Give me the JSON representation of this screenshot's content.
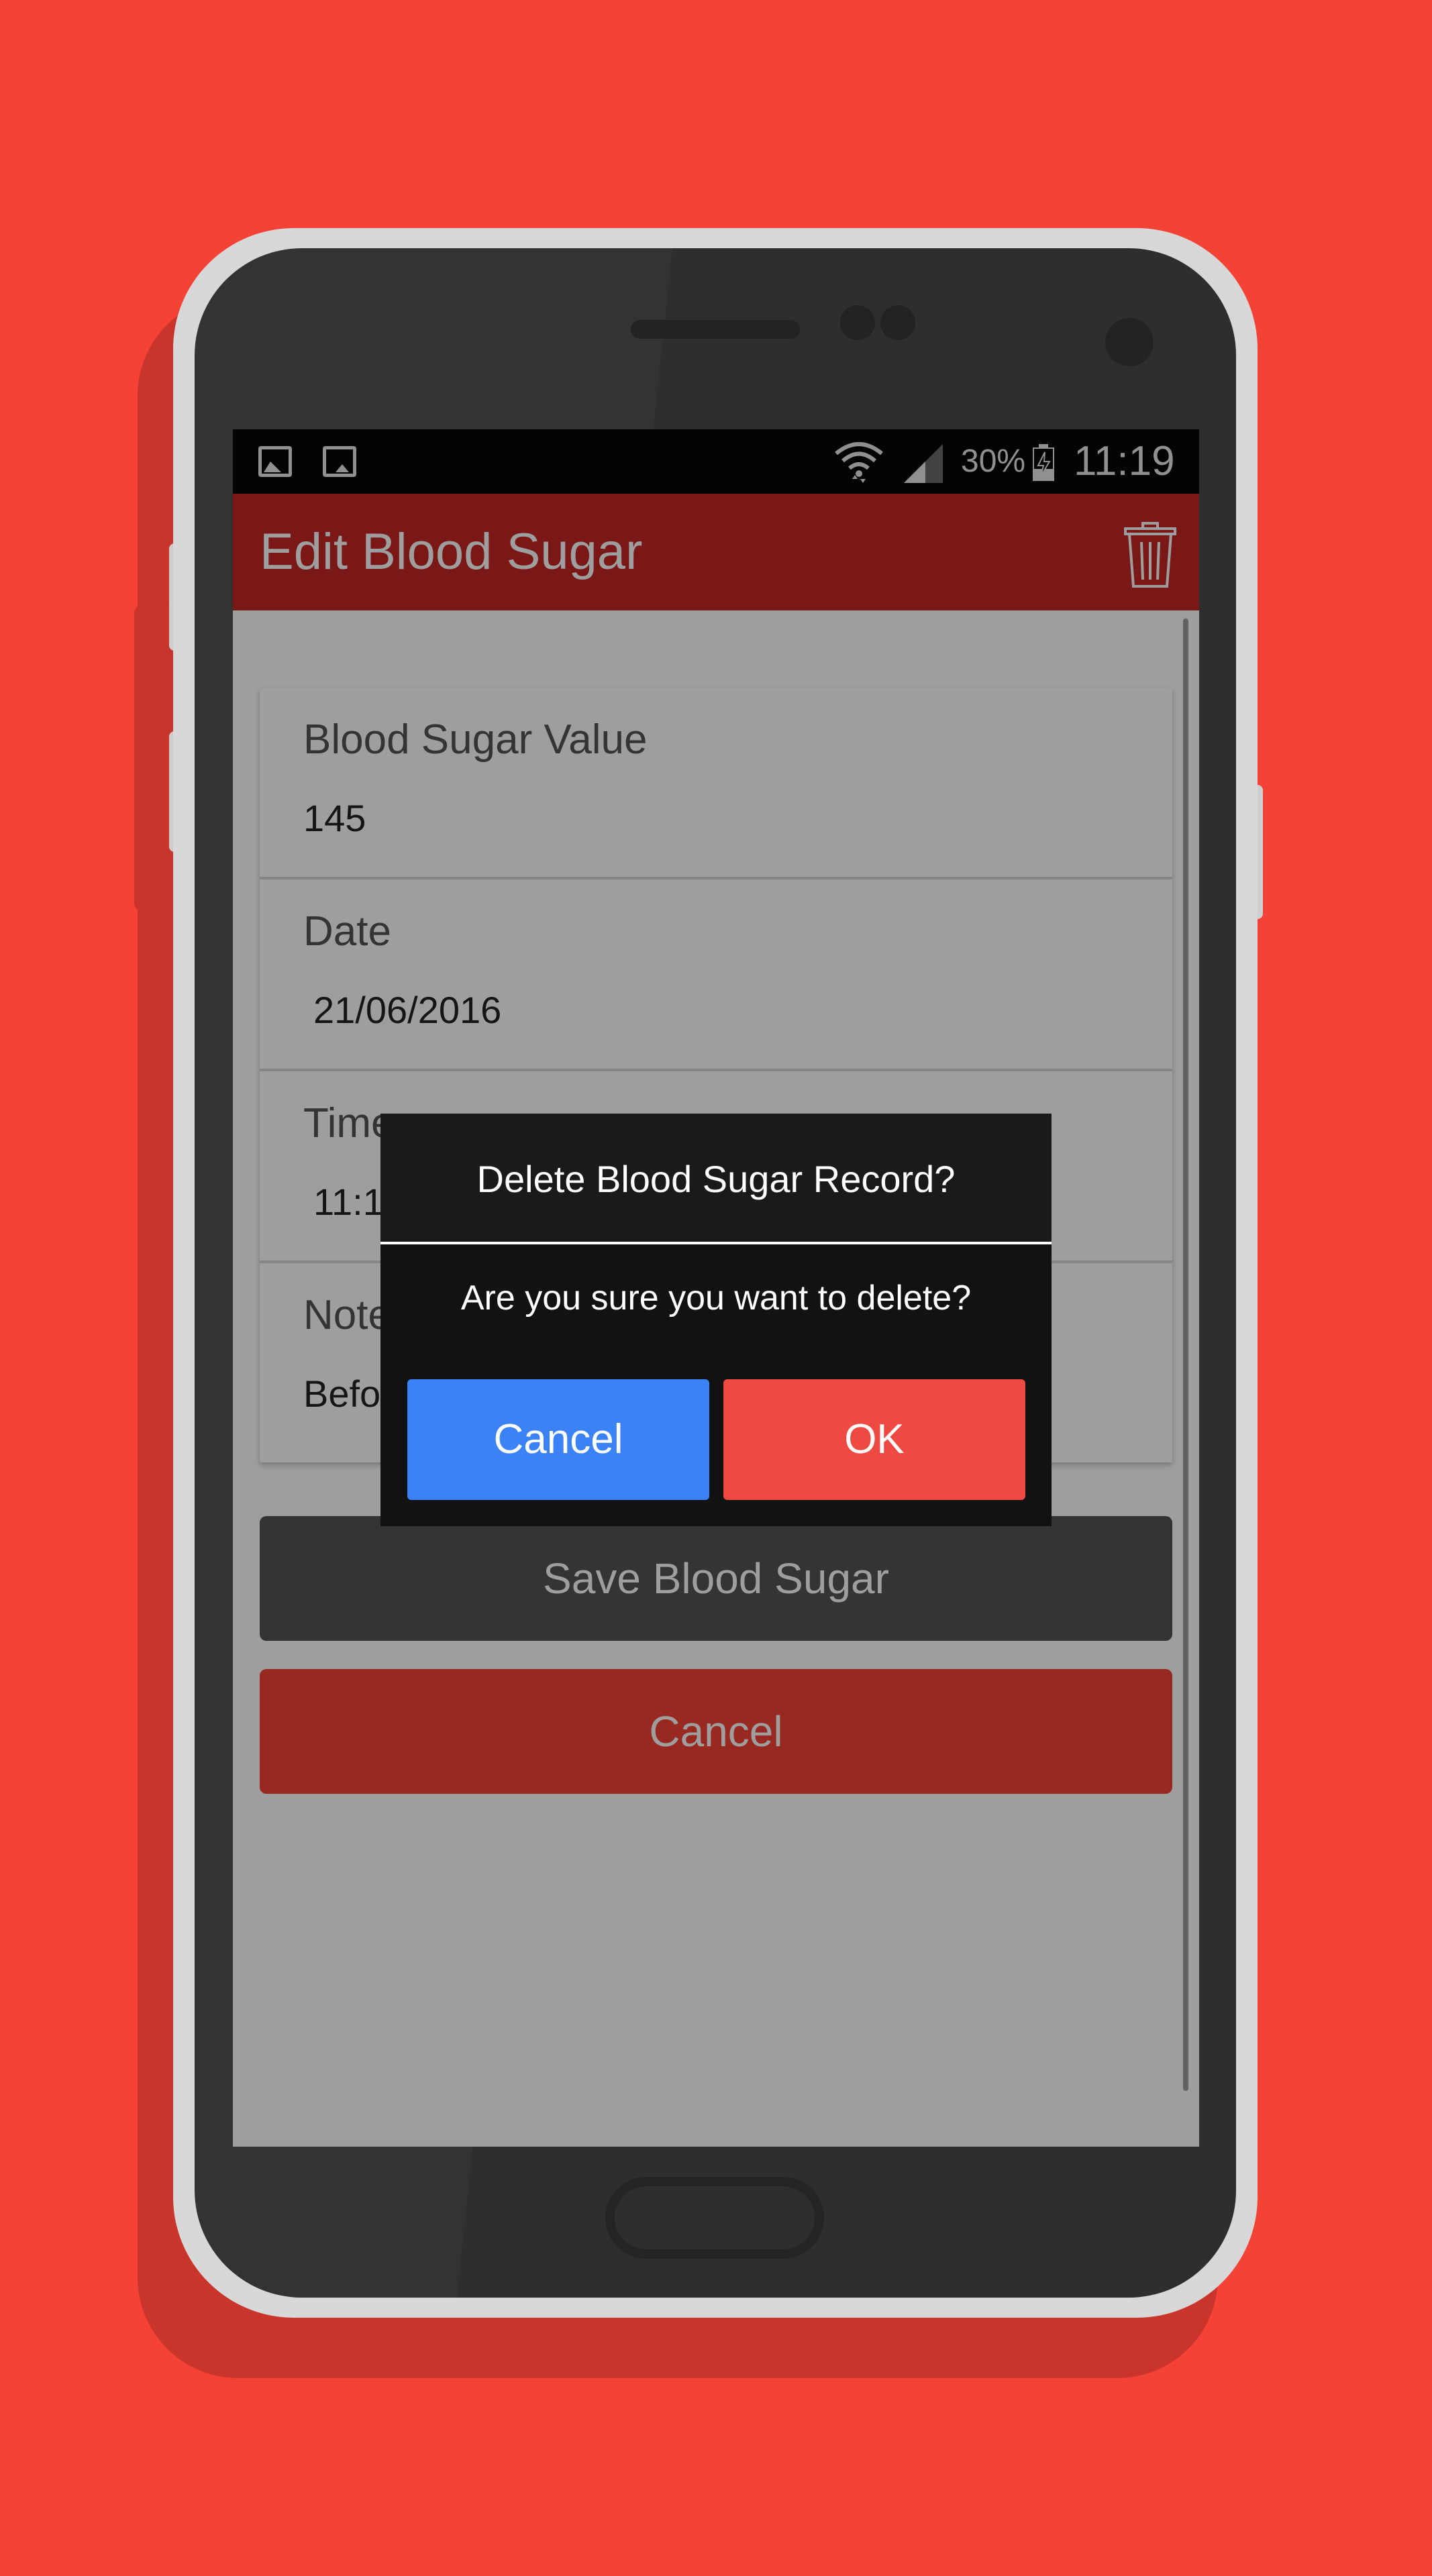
{
  "status_bar": {
    "battery_percent": "30%",
    "clock": "11:19",
    "icons": [
      "image-icon",
      "image-icon",
      "wifi-icon",
      "signal-icon",
      "battery-charging-icon"
    ]
  },
  "app_bar": {
    "title": "Edit Blood Sugar",
    "delete_icon": "trash-icon"
  },
  "form": {
    "fields": [
      {
        "label": "Blood Sugar Value",
        "value": "145"
      },
      {
        "label": "Date",
        "value": "21/06/2016"
      },
      {
        "label": "Time",
        "value": "11:18"
      },
      {
        "label": "Note",
        "value": "Before"
      }
    ],
    "save_label": "Save Blood Sugar",
    "cancel_label": "Cancel"
  },
  "dialog": {
    "title": "Delete Blood Sugar Record?",
    "message": "Are you sure you want to delete?",
    "cancel_label": "Cancel",
    "ok_label": "OK"
  },
  "colors": {
    "background": "#f44336",
    "app_bar": "#c62828",
    "dialog_cancel": "#3b82f6",
    "dialog_ok": "#ef4a42"
  }
}
